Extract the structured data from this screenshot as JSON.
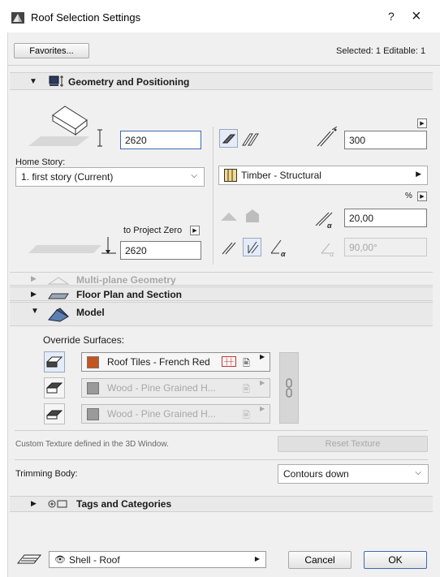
{
  "window": {
    "title": "Roof Selection Settings",
    "help": "?",
    "close": "×"
  },
  "toolbar": {
    "favorites_label": "Favorites...",
    "selection_info": "Selected: 1 Editable: 1"
  },
  "geometry": {
    "title": "Geometry and Positioning",
    "thickness_value": "2620",
    "home_story_label": "Home Story:",
    "home_story_value": "1. first story (Current)",
    "to_project_zero_label": "to Project Zero",
    "project_zero_value": "2620",
    "offset_value": "300",
    "material_value": "Timber - Structural",
    "percent_label": "%",
    "angle_value": "20,00",
    "angle2_value": "90,00°"
  },
  "sections": {
    "multiplane": "Multi-plane Geometry",
    "floorplan": "Floor Plan and Section",
    "model": "Model",
    "tags": "Tags and Categories"
  },
  "model": {
    "override_label": "Override Surfaces:",
    "surfaces": [
      {
        "name": "Roof Tiles - French Red",
        "color": "#c4561e",
        "active": true
      },
      {
        "name": "Wood - Pine Grained H...",
        "color": "#9a9a9a",
        "active": false
      },
      {
        "name": "Wood - Pine Grained H...",
        "color": "#9a9a9a",
        "active": false
      }
    ],
    "custom_texture_text": "Custom Texture defined in the 3D Window.",
    "reset_texture_label": "Reset Texture",
    "trimming_label": "Trimming Body:",
    "trimming_value": "Contours down"
  },
  "footer": {
    "layer_value": "Shell - Roof",
    "cancel_label": "Cancel",
    "ok_label": "OK"
  },
  "colors": {
    "accent": "#3c6ab4",
    "panel": "#f0f0f0"
  }
}
